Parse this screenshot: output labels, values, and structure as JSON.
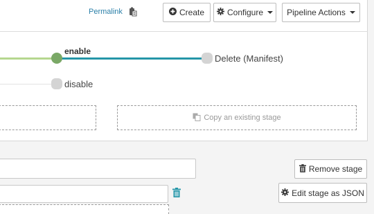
{
  "header": {
    "permalink": "Permalink",
    "create_label": "Create",
    "configure_label": "Configure",
    "pipeline_actions_label": "Pipeline Actions"
  },
  "graph": {
    "nodes": {
      "enable": "enable",
      "delete": "Delete (Manifest)",
      "disable": "disable"
    }
  },
  "stage_actions": {
    "copy_existing": "Copy an existing stage",
    "remove_stage": "Remove stage",
    "edit_json": "Edit stage as JSON"
  },
  "icons": {
    "create": "plus-circle-icon",
    "configure": "gear-icon",
    "permalink": "clipboard-icon",
    "copy": "copy-icon",
    "trash": "trash-icon"
  },
  "colors": {
    "accent": "#2596a8",
    "link": "#2a7fa8",
    "enabled_node": "#7aa866",
    "enabled_edge": "#b5d78f"
  }
}
